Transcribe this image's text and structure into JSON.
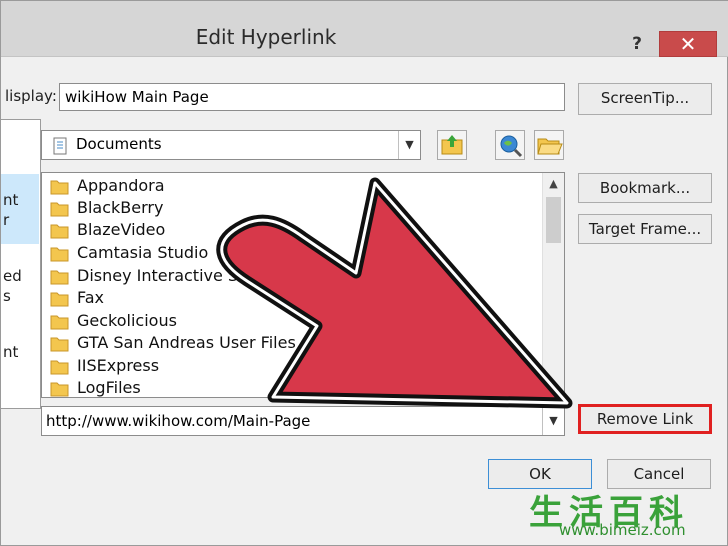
{
  "window": {
    "title": "Edit Hyperlink",
    "help_label": "?",
    "close_label": "✕"
  },
  "left_panel": {
    "items": [
      "nt",
      "r",
      "ed",
      "s",
      "nt"
    ]
  },
  "text_to_display": {
    "label": "lisplay:",
    "value": "wikiHow Main Page"
  },
  "buttons": {
    "screentip": "ScreenTip...",
    "bookmark": "Bookmark...",
    "target_frame": "Target Frame...",
    "remove_link": "Remove Link",
    "ok": "OK",
    "cancel": "Cancel"
  },
  "look_in": {
    "value": "Documents"
  },
  "files": [
    "Appandora",
    "BlackBerry",
    "BlazeVideo",
    "Camtasia Studio",
    "Disney Interactive Studios",
    "Fax",
    "Geckolicious",
    "GTA San Andreas User Files",
    "IISExpress",
    "LogFiles"
  ],
  "address": {
    "value": "http://www.wikihow.com/Main-Page"
  },
  "watermark": {
    "chinese": "生活百科",
    "url": "www.bimeiz.com"
  },
  "colors": {
    "arrow_fill": "#d7384a",
    "highlight_border": "#e02020",
    "close_button": "#c94b4b",
    "folder_yellow": "#f3c64e"
  }
}
